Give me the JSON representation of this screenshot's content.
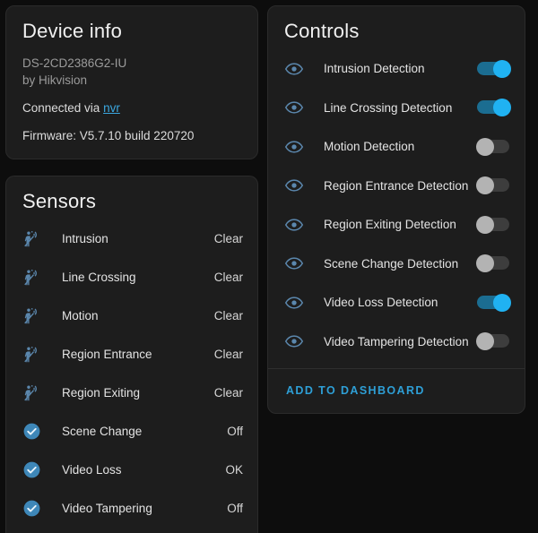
{
  "device_info": {
    "title": "Device info",
    "model": "DS-2CD2386G2-IU",
    "vendor": "by Hikvision",
    "connected_prefix": "Connected via ",
    "connected_link": "nvr",
    "firmware": "Firmware: V5.7.10 build 220720"
  },
  "sensors": {
    "title": "Sensors",
    "rows": [
      {
        "icon": "motion-person-icon",
        "label": "Intrusion",
        "value": "Clear"
      },
      {
        "icon": "motion-person-icon",
        "label": "Line Crossing",
        "value": "Clear"
      },
      {
        "icon": "motion-person-icon",
        "label": "Motion",
        "value": "Clear"
      },
      {
        "icon": "motion-person-icon",
        "label": "Region Entrance",
        "value": "Clear"
      },
      {
        "icon": "motion-person-icon",
        "label": "Region Exiting",
        "value": "Clear"
      },
      {
        "icon": "check-circle-icon",
        "label": "Scene Change",
        "value": "Off"
      },
      {
        "icon": "check-circle-icon",
        "label": "Video Loss",
        "value": "OK"
      },
      {
        "icon": "check-circle-icon",
        "label": "Video Tampering",
        "value": "Off"
      }
    ]
  },
  "controls": {
    "title": "Controls",
    "rows": [
      {
        "icon": "eye-icon",
        "label": "Intrusion Detection",
        "state": "on"
      },
      {
        "icon": "eye-icon",
        "label": "Line Crossing Detection",
        "state": "on"
      },
      {
        "icon": "eye-icon",
        "label": "Motion Detection",
        "state": "off"
      },
      {
        "icon": "eye-icon",
        "label": "Region Entrance Detection",
        "state": "off"
      },
      {
        "icon": "eye-icon",
        "label": "Region Exiting Detection",
        "state": "off"
      },
      {
        "icon": "eye-icon",
        "label": "Scene Change Detection",
        "state": "off"
      },
      {
        "icon": "eye-icon",
        "label": "Video Loss Detection",
        "state": "on"
      },
      {
        "icon": "eye-icon",
        "label": "Video Tampering Detection",
        "state": "off"
      }
    ],
    "action_label": "ADD TO DASHBOARD"
  },
  "colors": {
    "page_bg": "#0d0d0d",
    "card_bg": "#1d1d1d",
    "accent": "#20b2f2",
    "link": "#2e9fd6",
    "icon_blue": "#5b87ad",
    "toggle_on_track": "#1b6d91",
    "toggle_off_knob": "#b3b3b3"
  }
}
